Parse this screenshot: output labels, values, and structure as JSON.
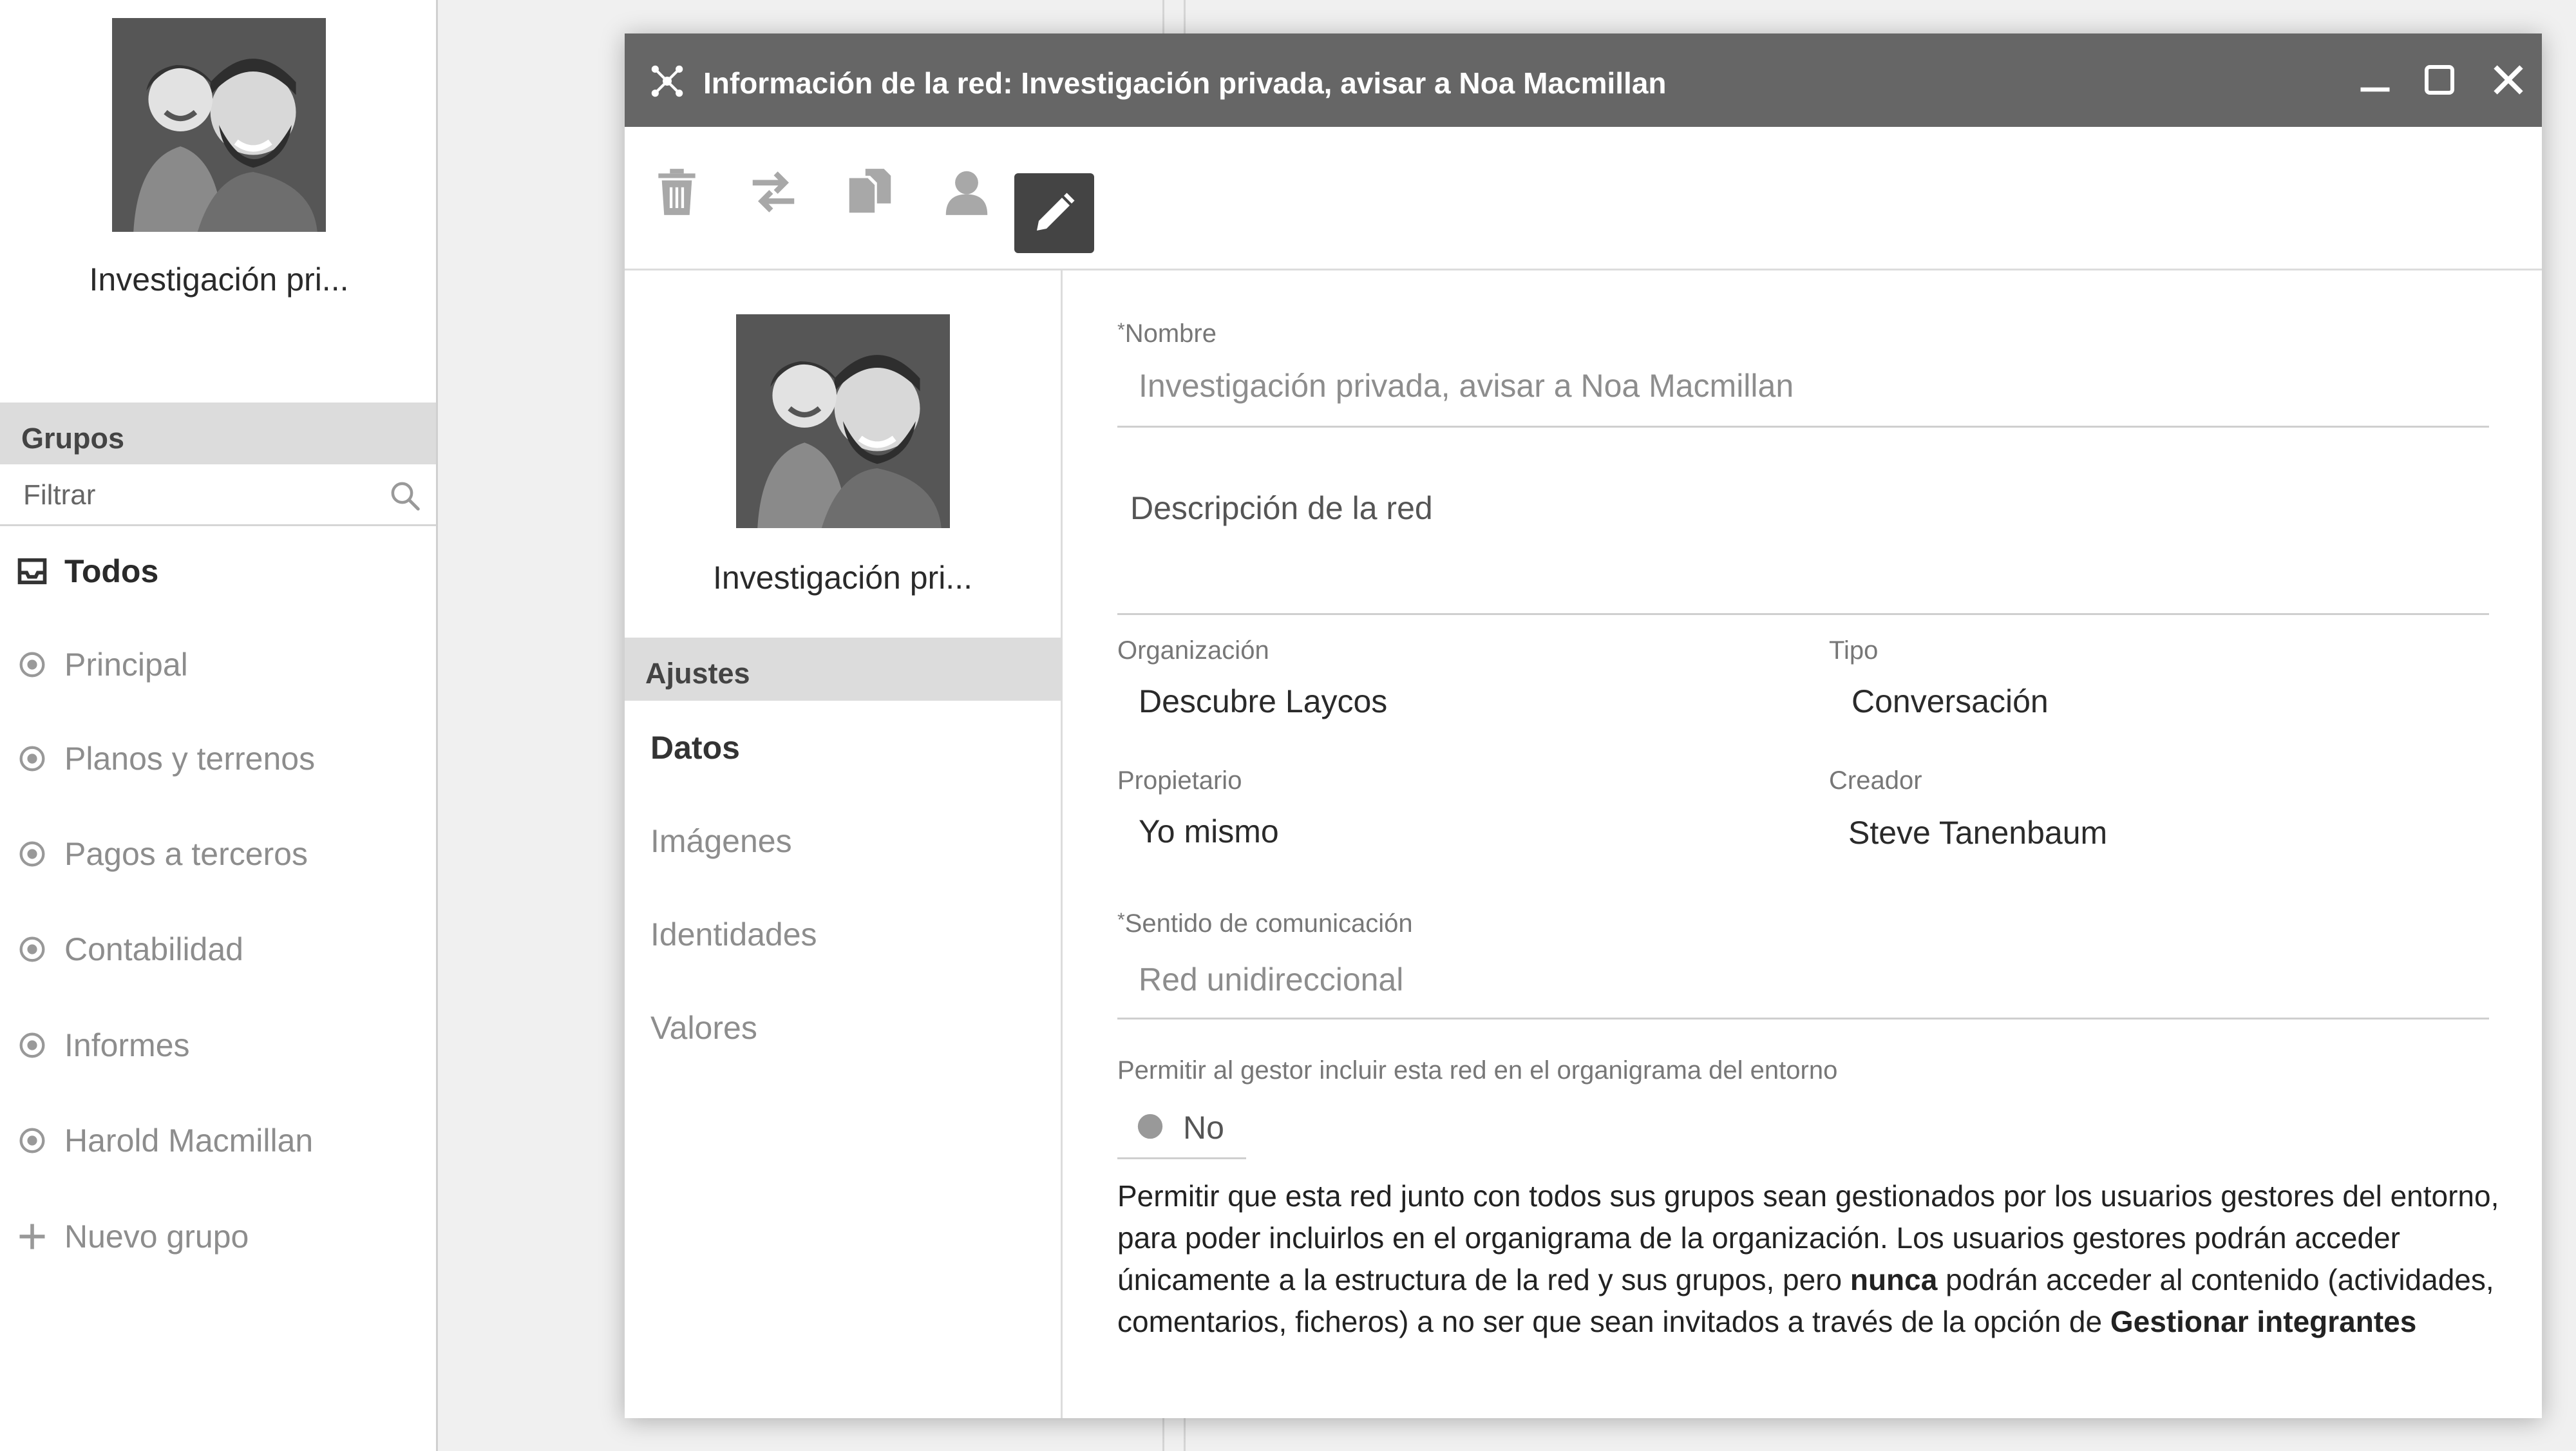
{
  "sidebar": {
    "profile_name": "Investigación pri...",
    "groups_header": "Grupos",
    "filter_placeholder": "Filtrar",
    "items": [
      {
        "label": "Todos",
        "icon": "inbox-icon",
        "active": true
      },
      {
        "label": "Principal",
        "icon": "radio-dot-icon"
      },
      {
        "label": "Planos y terrenos",
        "icon": "radio-dot-icon"
      },
      {
        "label": "Pagos a terceros",
        "icon": "radio-dot-icon"
      },
      {
        "label": "Contabilidad",
        "icon": "radio-dot-icon"
      },
      {
        "label": "Informes",
        "icon": "radio-dot-icon"
      },
      {
        "label": "Harold Macmillan",
        "icon": "radio-dot-icon"
      },
      {
        "label": "Nuevo grupo",
        "icon": "plus-icon"
      }
    ]
  },
  "dialog": {
    "title": "Información de la red: Investigación privada, avisar a Noa Macmillan",
    "toolbar": [
      "trash-icon",
      "transfer-icon",
      "copy-icon",
      "user-icon",
      "pencil-icon"
    ],
    "profile_name": "Investigación pri...",
    "settings_header": "Ajustes",
    "menu": {
      "datos": "Datos",
      "imagenes": "Imágenes",
      "identidades": "Identidades",
      "valores": "Valores"
    },
    "form": {
      "required_mark": "*",
      "nombre_label": "Nombre",
      "nombre_value": "Investigación privada, avisar a Noa Macmillan",
      "descripcion_placeholder": "Descripción de la red",
      "organizacion_label": "Organización",
      "organizacion_value": "Descubre Laycos",
      "tipo_label": "Tipo",
      "tipo_value": "Conversación",
      "propietario_label": "Propietario",
      "propietario_value": "Yo mismo",
      "creador_label": "Creador",
      "creador_value": "Steve Tanenbaum",
      "sentido_label": "Sentido de comunicación",
      "sentido_value": "Red unidireccional",
      "permitir_label": "Permitir al gestor incluir esta red en el organigrama del entorno",
      "permitir_value": "No",
      "help_part1": "Permitir que esta red junto con todos sus grupos sean gestionados por los usuarios gestores del entorno, para poder incluirlos en el organigrama de la organización. Los usuarios gestores podrán acceder únicamente a la estructura de la red y sus grupos, pero ",
      "help_bold1": "nunca",
      "help_part2": " podrán acceder al contenido (actividades, comentarios, ficheros) a no ser que sean invitados a través de la opción de ",
      "help_bold2": "Gestionar integrantes"
    }
  }
}
